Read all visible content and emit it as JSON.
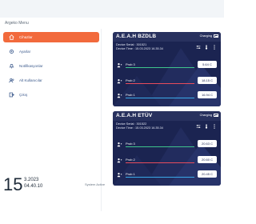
{
  "sidebar": {
    "title": "Argeko Menu",
    "items": [
      {
        "label": "Cihazlar",
        "icon": "home-icon",
        "active": true
      },
      {
        "label": "Ayarlar",
        "icon": "gear-icon",
        "active": false
      },
      {
        "label": "Notifikasyonlar",
        "icon": "bell-icon",
        "active": false
      },
      {
        "label": "Alt Kullanıcılar",
        "icon": "users-icon",
        "active": false
      },
      {
        "label": "Çıkış",
        "icon": "logout-icon",
        "active": false
      }
    ]
  },
  "datetime": {
    "day": "15",
    "month_year": "3.2023",
    "time": "04.40.10"
  },
  "footer": {
    "text": "System Active"
  },
  "devices": [
    {
      "name": "A.E.A.H BZDLB",
      "charging": "Charging",
      "serial": "Device Serial : 301521",
      "time": "Device Time : 15.03.2023 16.35.34",
      "probes": [
        {
          "label": "Prob 3",
          "value": "5.64 C",
          "color": "green"
        },
        {
          "label": "Prob 2",
          "value": "18.15 C",
          "color": "red"
        },
        {
          "label": "Prob 1",
          "value": "16.94 C",
          "color": "blue"
        }
      ]
    },
    {
      "name": "A.E.A.H ETÜV",
      "charging": "Charging",
      "serial": "Device Serial : 301522",
      "time": "Device Time : 15.03.2023 16.35.34",
      "probes": [
        {
          "label": "Prob 3",
          "value": "20.63 C",
          "color": "green"
        },
        {
          "label": "Prob 2",
          "value": "20.60 C",
          "color": "red"
        },
        {
          "label": "Prob 1",
          "value": "20.45 C",
          "color": "blue"
        }
      ]
    }
  ],
  "colors": {
    "accent": "#f26a3c",
    "card": "#1b2451",
    "text_dark": "#1e2a38"
  }
}
